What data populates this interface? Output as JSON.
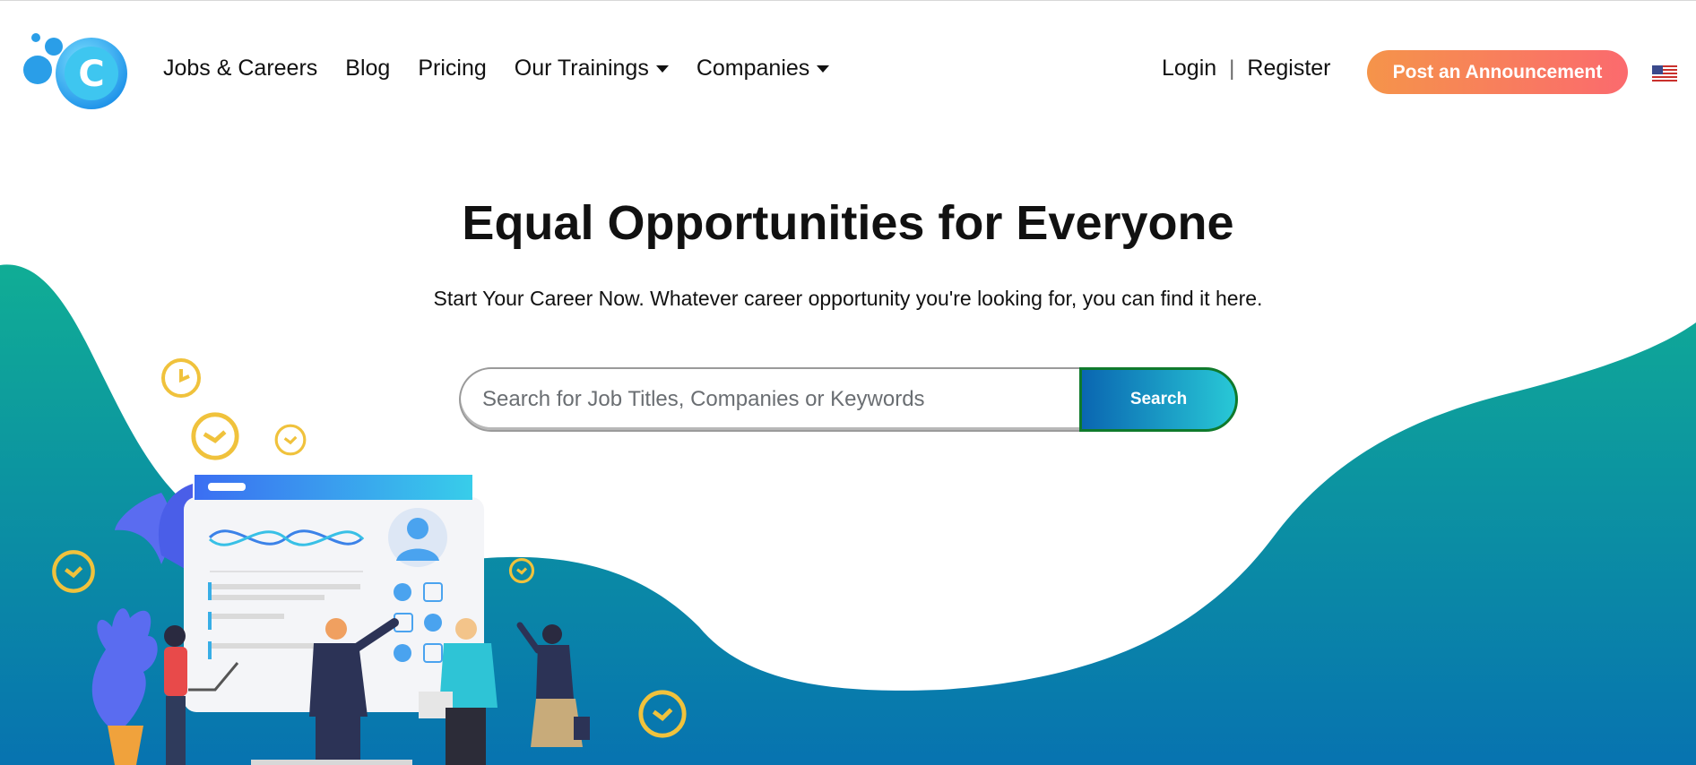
{
  "header": {
    "logo_icon": "bubbles-c-logo-icon",
    "nav": [
      {
        "label": "Jobs & Careers",
        "has_dropdown": false
      },
      {
        "label": "Blog",
        "has_dropdown": false
      },
      {
        "label": "Pricing",
        "has_dropdown": false
      },
      {
        "label": "Our Trainings",
        "has_dropdown": true
      },
      {
        "label": "Companies",
        "has_dropdown": true
      }
    ],
    "login_label": "Login",
    "separator": "|",
    "register_label": "Register",
    "post_button_label": "Post an Announcement",
    "language_icon": "us-flag-icon"
  },
  "hero": {
    "title": "Equal Opportunities for Everyone",
    "subtitle": "Start Your Career Now. Whatever career opportunity you're looking for, you can find it here.",
    "search": {
      "placeholder": "Search for Job Titles, Companies or Keywords",
      "value": "",
      "button_label": "Search"
    }
  },
  "colors": {
    "wave_top": "#10ad95",
    "wave_bottom": "#0773b0",
    "post_button_start": "#f5944a",
    "post_button_end": "#fb6a6e",
    "search_button_start": "#0a66b1",
    "search_button_end": "#28c8d6",
    "clock_yellow": "#f0c23c"
  },
  "illustration": {
    "icons": [
      "clock-icon",
      "dashboard-screen",
      "avatar-icon",
      "checkbox-icon",
      "plant-icon",
      "people-team"
    ]
  }
}
